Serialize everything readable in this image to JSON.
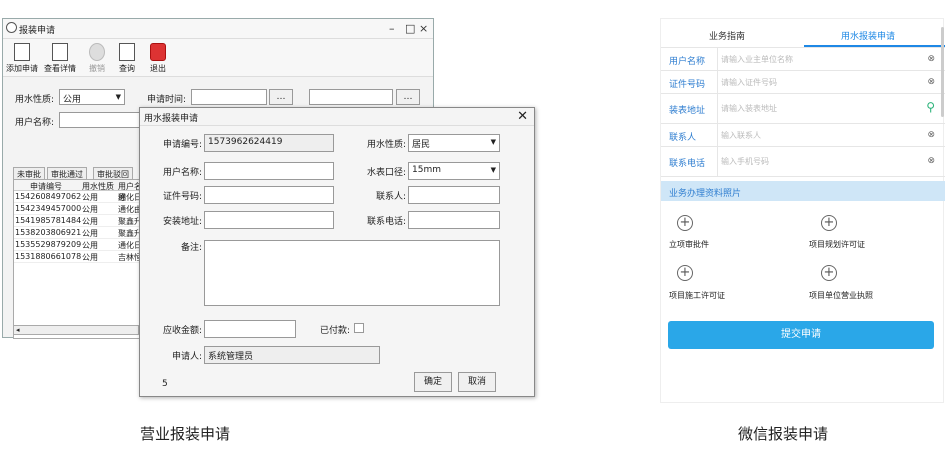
{
  "main_window": {
    "title": "报装申请",
    "controls": [
      "–",
      "□",
      "×"
    ],
    "toolbar": [
      {
        "label": "添加申请",
        "icon": "new-document-icon",
        "enabled": true
      },
      {
        "label": "查看详情",
        "icon": "details-icon",
        "enabled": true
      },
      {
        "label": "撤销",
        "icon": "undo-icon",
        "enabled": false
      },
      {
        "label": "查询",
        "icon": "search-icon",
        "enabled": true
      },
      {
        "label": "退出",
        "icon": "exit-icon",
        "enabled": true
      }
    ],
    "filter": {
      "water_type_label": "用水性质:",
      "water_type_value": "公用",
      "apply_time_label": "申请时间:",
      "date_button": "…",
      "user_name_label": "用户名称:"
    },
    "tabs": [
      "未审批",
      "审批通过",
      "审批驳回"
    ],
    "grid": {
      "columns": [
        "申请编号",
        "用水性质",
        "用户名称"
      ],
      "rows": [
        [
          "1542608497062",
          "公用",
          "通化日"
        ],
        [
          "1542349457000",
          "公用",
          "通化由"
        ],
        [
          "1541985781484",
          "公用",
          "聚鑫升"
        ],
        [
          "1538203806921",
          "公用",
          "聚鑫升"
        ],
        [
          "1535529879209",
          "公用",
          "通化日"
        ],
        [
          "1531880661078",
          "公用",
          "吉林恒"
        ]
      ]
    }
  },
  "dialog": {
    "title": "用水报装申请",
    "fields": {
      "apply_no_label": "申请编号:",
      "apply_no_value": "1573962624419",
      "water_type_label": "用水性质:",
      "water_type_value": "居民",
      "user_name_label": "用户名称:",
      "user_name_value": "",
      "meter_label": "水表口径:",
      "meter_value": "15mm",
      "cert_label": "证件号码:",
      "contact_label": "联系人:",
      "address_label": "安装地址:",
      "phone_label": "联系电话:",
      "remark_label": "备注:",
      "amount_label": "应收金额:",
      "paid_label": "已付款:",
      "applicant_label": "申请人:",
      "applicant_value": "系统管理员"
    },
    "footer_number": "5",
    "confirm": "确定",
    "cancel": "取消"
  },
  "mobile": {
    "tabs": [
      "业务指南",
      "用水报装申请"
    ],
    "active_tab": 1,
    "fields": [
      {
        "label": "用户名称",
        "placeholder": "请输入业主单位名称",
        "icon": "clear-icon"
      },
      {
        "label": "证件号码",
        "placeholder": "请输入证件号码",
        "icon": "clear-icon"
      },
      {
        "label": "装表地址",
        "placeholder": "请输入装表地址",
        "icon": "location-pin-icon"
      },
      {
        "label": "联系人",
        "placeholder": "输入联系人",
        "icon": "clear-icon"
      },
      {
        "label": "联系电话",
        "placeholder": "输入手机号码",
        "icon": "clear-icon"
      }
    ],
    "section_title": "业务办理资料照片",
    "uploads": [
      "立项审批件",
      "项目规划许可证",
      "项目施工许可证",
      "项目单位营业执照"
    ],
    "submit": "提交申请",
    "accent": "#2aa7e8"
  },
  "captions": {
    "left": "营业报装申请",
    "right": "微信报装申请"
  }
}
